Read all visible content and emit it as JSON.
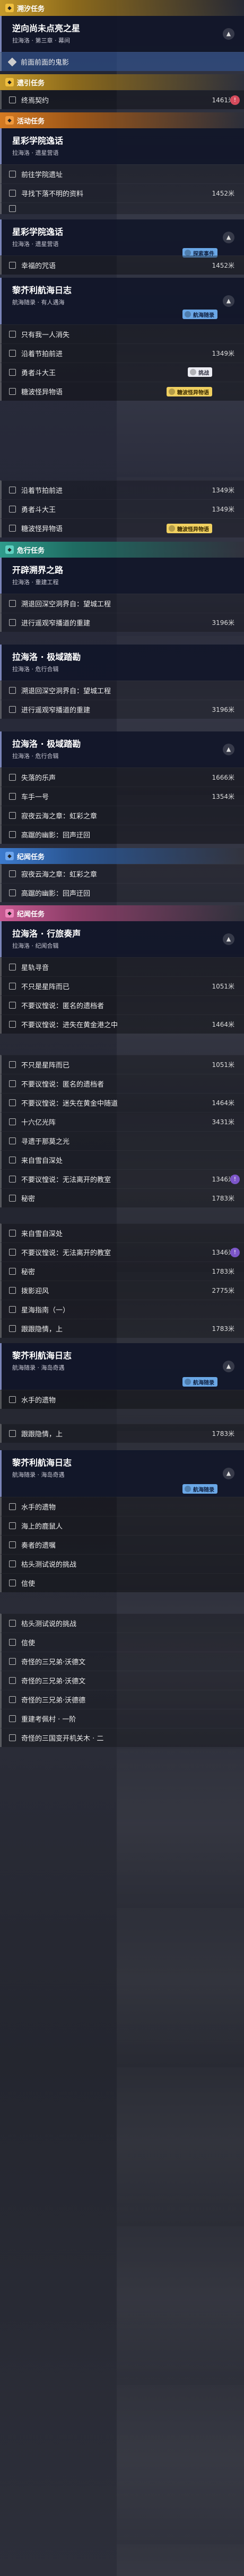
{
  "sections": [
    {
      "label": "溯汐任务",
      "color": "yellow"
    },
    {
      "label": "遗引任务",
      "color": "yellow"
    },
    {
      "label": "活动任务",
      "color": "orange"
    },
    {
      "label": "危行任务",
      "color": "teal"
    },
    {
      "label": "纪闻任务",
      "color": "blue"
    },
    {
      "label": "纪闻任务",
      "color": "pink"
    }
  ],
  "quests": {
    "q1": {
      "title": "逆向尚未点亮之星",
      "subtitle": "拉海洛 · 第三章 · 幕间"
    },
    "q2": {
      "title": "星彩学院逸话",
      "subtitle": "拉海洛 · 遗星营语"
    },
    "q3": {
      "title": "星彩学院逸话",
      "subtitle": "拉海洛 · 遗星营语"
    },
    "q4": {
      "title": "黎芥利航海日志",
      "subtitle": "航海随录 · 有人遇海"
    },
    "q5": {
      "title": "开辟溯界之路",
      "subtitle": "拉海洛 · 重建工程"
    },
    "q6": {
      "title": "拉海洛 · 极域踏勘",
      "subtitle": "拉海洛 · 危行合辑"
    },
    "q7": {
      "title": "拉海洛 · 极域踏勘",
      "subtitle": "拉海洛 · 危行合辑"
    },
    "q8": {
      "title": "拉海洛 · 行旅奏声",
      "subtitle": "拉海洛 · 纪闻合辑"
    },
    "q9": {
      "title": "黎芥利航海日志",
      "subtitle": "航海随录 · 海岛奇遇"
    },
    "q10": {
      "title": "黎芥利航海日志",
      "subtitle": "航海随录 · 海岛奇遇"
    }
  },
  "badges": {
    "b1": "探索事件",
    "b2": "航海随录",
    "b3": "挑战",
    "b4": "糖波怪异物语",
    "b5": "糖波怪异物语",
    "b6": "航海随录",
    "b7": "航海随录"
  },
  "rows": {
    "r1": {
      "label": "前面前面的鬼影",
      "dist": ""
    },
    "r2": {
      "label": "终焉契约",
      "dist": "1461米"
    },
    "r3": {
      "label": "前往学院遗址",
      "dist": ""
    },
    "r4": {
      "label": "寻找下落不明的资料",
      "dist": "1452米"
    },
    "r5": {
      "label": "",
      "dist": ""
    },
    "r6": {
      "label": "幸福的咒语",
      "dist": "1452米"
    },
    "r7": {
      "label": "只有我一人消失",
      "dist": ""
    },
    "r8": {
      "label": "沿着节拍前进",
      "dist": "1349米"
    },
    "r9": {
      "label": "勇者斗大王",
      "dist": ""
    },
    "r10": {
      "label": "糖波怪异物语",
      "dist": ""
    },
    "r11": {
      "label": "沿着节拍前进",
      "dist": "1349米"
    },
    "r12": {
      "label": "勇者斗大王",
      "dist": "1349米"
    },
    "r13": {
      "label": "糖波怪异物语",
      "dist": ""
    },
    "r14": {
      "label": "溯退回深空洞界自：望城工程",
      "dist": ""
    },
    "r15": {
      "label": "进行遥观窄播道的重建",
      "dist": "3196米"
    },
    "r16": {
      "label": "溯退回深空洞界自：望城工程",
      "dist": ""
    },
    "r17": {
      "label": "进行遥观窄播道的重建",
      "dist": "3196米"
    },
    "r18": {
      "label": "失落的乐声",
      "dist": "1666米"
    },
    "r19": {
      "label": "车手一号",
      "dist": "1354米"
    },
    "r20": {
      "label": "寂夜云海之章：虹彩之章",
      "dist": ""
    },
    "r21": {
      "label": "高踞的幽影：回声迂回",
      "dist": ""
    },
    "r22": {
      "label": "寂夜云海之章：虹彩之章",
      "dist": ""
    },
    "r23": {
      "label": "高踞的幽影：回声迂回",
      "dist": ""
    },
    "r24": {
      "label": "星轨寻音",
      "dist": ""
    },
    "r25": {
      "label": "不只是星阵而已",
      "dist": "1051米"
    },
    "r26": {
      "label": "不要议惶说：匿名的遗档者",
      "dist": ""
    },
    "r27": {
      "label": "不要议惶说：进失在黄金港之中",
      "dist": "1464米"
    },
    "r28": {
      "label": "不只是星阵而已",
      "dist": "1051米"
    },
    "r29": {
      "label": "不要议惶说：匿名的遗档者",
      "dist": ""
    },
    "r30": {
      "label": "不要议惶说：迷失在黄金中随道",
      "dist": "1464米"
    },
    "r31": {
      "label": "十六亿光阵",
      "dist": "3431米"
    },
    "r32": {
      "label": "寻遗于那莫之光",
      "dist": ""
    },
    "r33": {
      "label": "来自雪自深处",
      "dist": ""
    },
    "r34": {
      "label": "不要议惶说：无法离开的教室",
      "dist": "1346米"
    },
    "r35": {
      "label": "秘密",
      "dist": "1783米"
    },
    "r36": {
      "label": "来自雪自深处",
      "dist": ""
    },
    "r37": {
      "label": "不要议惶说：无法离开的教室",
      "dist": "1346米"
    },
    "r38": {
      "label": "秘密",
      "dist": "1783米"
    },
    "r39": {
      "label": "拨影迎风",
      "dist": "2775米"
    },
    "r40": {
      "label": "星海指南（一）",
      "dist": ""
    },
    "r41": {
      "label": "跟跟隐情，上",
      "dist": "1783米"
    },
    "r42": {
      "label": "水手的遗物",
      "dist": ""
    },
    "r43": {
      "label": "跟跟隐情，上",
      "dist": "1783米"
    },
    "r44": {
      "label": "水手的遗物",
      "dist": ""
    },
    "r45": {
      "label": "海上的鹿鼠人",
      "dist": ""
    },
    "r46": {
      "label": "奏者的遗嘱",
      "dist": ""
    },
    "r47": {
      "label": "枯头测试说的挑战",
      "dist": ""
    },
    "r48": {
      "label": "信使",
      "dist": ""
    },
    "r49": {
      "label": "枯头测试说的挑战",
      "dist": ""
    },
    "r50": {
      "label": "信使",
      "dist": ""
    },
    "r51": {
      "label": "奇怪的三兄弟·沃德文",
      "dist": ""
    },
    "r52": {
      "label": "奇怪的三兄弟·沃德文",
      "dist": ""
    },
    "r53": {
      "label": "奇怪的三兄弟·沃德德",
      "dist": ""
    },
    "r54": {
      "label": "重建考佩村 · 一阶",
      "dist": ""
    },
    "r55": {
      "label": "奇怪的三国变开机关木 · 二",
      "dist": ""
    }
  }
}
